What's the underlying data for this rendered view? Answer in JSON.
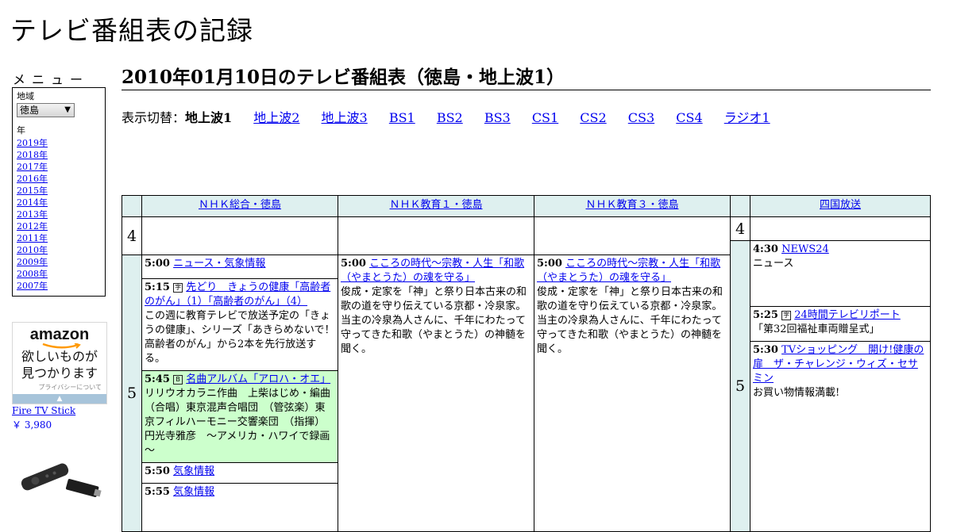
{
  "site_title": "テレビ番組表の記録",
  "sidebar": {
    "menu_title": "メニュー",
    "region_label": "地域",
    "region_value": "徳島",
    "year_label": "年",
    "years": [
      "2019年",
      "2018年",
      "2017年",
      "2016年",
      "2015年",
      "2014年",
      "2013年",
      "2012年",
      "2011年",
      "2010年",
      "2009年",
      "2008年",
      "2007年"
    ]
  },
  "ad": {
    "logo": "amazon",
    "text_line1": "欲しいものが",
    "text_line2": "見つかります",
    "privacy": "プライバシーについて",
    "product_name": "Fire TV Stick",
    "product_price": "￥ 3,980"
  },
  "heading": "2010年01月10日のテレビ番組表（徳島・地上波1）",
  "switcher": {
    "label": "表示切替：",
    "current": "地上波1",
    "links": [
      "地上波2",
      "地上波3",
      "BS1",
      "BS2",
      "BS3",
      "CS1",
      "CS2",
      "CS3",
      "CS4",
      "ラジオ1"
    ]
  },
  "channels": [
    "ＮＨＫ総合・徳島",
    "ＮＨＫ教育１・徳島",
    "ＮＨＫ教育３・徳島",
    "四国放送"
  ],
  "hours": [
    "4",
    "5"
  ],
  "programs": {
    "nhk_sogo": [
      {
        "time": "5:00",
        "title": "ニュース・気象情報",
        "desc": ""
      },
      {
        "time": "5:15",
        "title": "先どり　きょうの健康「高齢者のがん」（1）「高齢者のがん」（4）",
        "desc": "この週に教育テレビで放送予定の「きょうの健康」、シリーズ「あきらめないで！高齢者のがん」から2本を先行放送する。"
      },
      {
        "time": "5:45",
        "title": "名曲アルバム「アロハ・オエ」",
        "desc": "リリウオカラニ作曲　上柴はじめ・編曲　（合唱）東京混声合唱団　（管弦楽）東京フィルハーモニー交響楽団　（指揮）円光寺雅彦　～アメリカ・ハワイで録画～"
      },
      {
        "time": "5:50",
        "title": "気象情報",
        "desc": ""
      },
      {
        "time": "5:55",
        "title": "気象情報",
        "desc": ""
      }
    ],
    "nhk_kyoiku1": [
      {
        "time": "5:00",
        "title": "こころの時代～宗教・人生「和歌（やまとうた）の魂を守る」",
        "desc": "俊成・定家を「神」と祭り日本古来の和歌の道を守り伝えている京都・冷泉家。当主の冷泉為人さんに、千年にわたって守ってきた和歌（やまとうた）の神髄を聞く。"
      }
    ],
    "nhk_kyoiku3": [
      {
        "time": "5:00",
        "title": "こころの時代～宗教・人生「和歌（やまとうた）の魂を守る」",
        "desc": "俊成・定家を「神」と祭り日本古来の和歌の道を守り伝えている京都・冷泉家。当主の冷泉為人さんに、千年にわたって守ってきた和歌（やまとうた）の神髄を聞く。"
      }
    ],
    "shikoku": [
      {
        "time": "4:30",
        "title": "NEWS24",
        "desc": "ニュース"
      },
      {
        "time": "5:25",
        "title": "24時間テレビリポート",
        "desc": "「第32回福祉車両贈呈式」"
      },
      {
        "time": "5:30",
        "title": "TVショッピング　開け!健康の扉　ザ・チャレンジ・ウィズ・セサミン",
        "desc": "お買い物情報満載!"
      }
    ]
  }
}
